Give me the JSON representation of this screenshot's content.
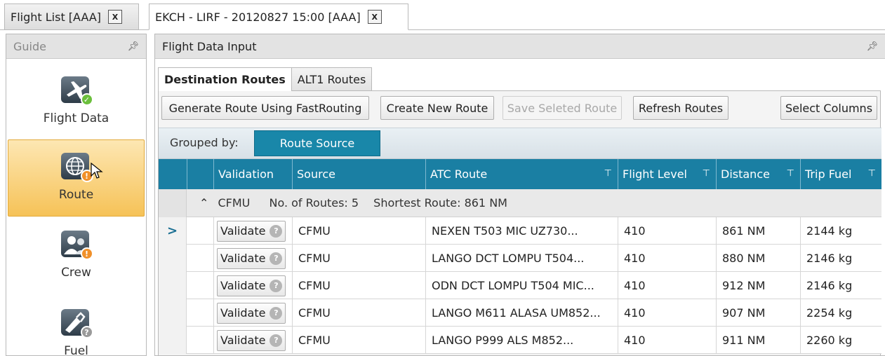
{
  "doc_tabs": [
    {
      "label": "Flight List [AAA]",
      "close": "X"
    },
    {
      "label": "EKCH - LIRF - 20120827 15:00 [AAA]",
      "close": "X"
    }
  ],
  "guide": {
    "title": "Guide",
    "items": [
      {
        "label": "Flight Data",
        "icon": "airplane-icon",
        "badge": "check",
        "badge_color": "#6bbf3c"
      },
      {
        "label": "Route",
        "icon": "globe-icon",
        "badge": "!",
        "badge_color": "#f0902a",
        "selected": true
      },
      {
        "label": "Crew",
        "icon": "crew-icon",
        "badge": "!",
        "badge_color": "#f0902a"
      },
      {
        "label": "Fuel",
        "icon": "fuel-pump-icon",
        "badge": "?",
        "badge_color": "#9a9a9a"
      }
    ]
  },
  "panel": {
    "title": "Flight Data Input"
  },
  "route_tabs": [
    "Destination Routes",
    "ALT1 Routes"
  ],
  "toolbar": {
    "generate": "Generate Route Using FastRouting",
    "create": "Create New Route",
    "save": "Save Seleted Route",
    "refresh": "Refresh Routes",
    "select_columns": "Select Columns"
  },
  "grouping": {
    "label": "Grouped by:",
    "chip": "Route Source"
  },
  "grid": {
    "columns": [
      "Validation",
      "Source",
      "ATC Route",
      "Flight Level",
      "Distance",
      "Trip Fuel"
    ],
    "group": {
      "name": "CFMU",
      "count_label": "No. of Routes: 5",
      "shortest_label": "Shortest Route: 861 NM"
    },
    "validate_label": "Validate",
    "current_row_marker": ">",
    "rows": [
      {
        "source": "CFMU",
        "route": "NEXEN T503 MIC UZ730...",
        "level": "410",
        "distance": "861 NM",
        "fuel": "2144 kg"
      },
      {
        "source": "CFMU",
        "route": "LANGO DCT LOMPU T504...",
        "level": "410",
        "distance": "880 NM",
        "fuel": "2146 kg"
      },
      {
        "source": "CFMU",
        "route": "ODN DCT LOMPU T504 MIC...",
        "level": "410",
        "distance": "912 NM",
        "fuel": "2146 kg"
      },
      {
        "source": "CFMU",
        "route": "LANGO M611 ALASA UM852...",
        "level": "410",
        "distance": "907 NM",
        "fuel": "2254 kg"
      },
      {
        "source": "CFMU",
        "route": "LANGO P999 ALS M852...",
        "level": "410",
        "distance": "911 NM",
        "fuel": "2260 kg"
      }
    ]
  },
  "colors": {
    "header_blue": "#1a7fa3",
    "chip_blue": "#1987a9",
    "selected_orange": "#f6c257"
  }
}
